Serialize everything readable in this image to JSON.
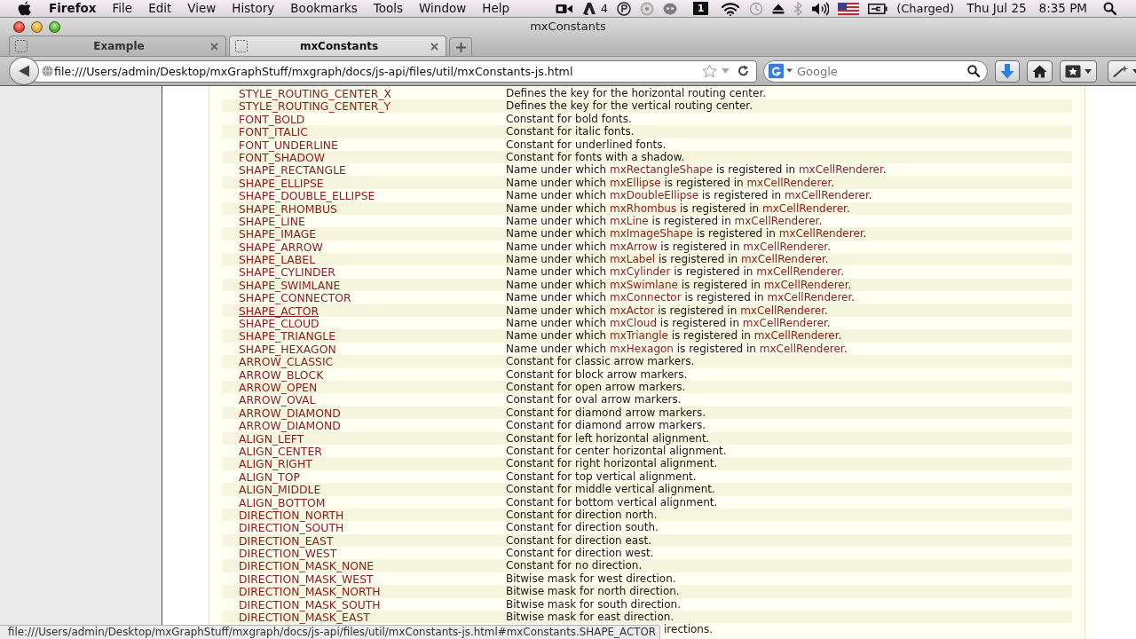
{
  "menu_bar": {
    "app_name": "Firefox",
    "menus": [
      "File",
      "Edit",
      "View",
      "History",
      "Bookmarks",
      "Tools",
      "Window",
      "Help"
    ],
    "extras": {
      "adobe_count": "4",
      "desktop_number": "1",
      "battery": "(Charged)",
      "date": "Thu Jul 25",
      "time": "8:35 PM"
    }
  },
  "window": {
    "title": "mxConstants"
  },
  "tabs": [
    {
      "label": "Example",
      "selected": false
    },
    {
      "label": "mxConstants",
      "selected": true
    }
  ],
  "toolbar": {
    "url": "file:///Users/admin/Desktop/mxGraphStuff/mxgraph/docs/js-api/files/util/mxConstants-js.html",
    "search": {
      "placeholder": "Google"
    }
  },
  "constants": {
    "rows": [
      {
        "name": "STYLE_ROUTING_CENTER_X",
        "hovered": false,
        "description": [
          {
            "text": "Defines the key for the horizontal routing center.",
            "link": false
          }
        ]
      },
      {
        "name": "STYLE_ROUTING_CENTER_Y",
        "hovered": false,
        "description": [
          {
            "text": "Defines the key for the vertical routing center.",
            "link": false
          }
        ]
      },
      {
        "name": "FONT_BOLD",
        "hovered": false,
        "description": [
          {
            "text": "Constant for bold fonts.",
            "link": false
          }
        ]
      },
      {
        "name": "FONT_ITALIC",
        "hovered": false,
        "description": [
          {
            "text": "Constant for italic fonts.",
            "link": false
          }
        ]
      },
      {
        "name": "FONT_UNDERLINE",
        "hovered": false,
        "description": [
          {
            "text": "Constant for underlined fonts.",
            "link": false
          }
        ]
      },
      {
        "name": "FONT_SHADOW",
        "hovered": false,
        "description": [
          {
            "text": "Constant for fonts with a shadow.",
            "link": false
          }
        ]
      },
      {
        "name": "SHAPE_RECTANGLE",
        "hovered": false,
        "description": [
          {
            "text": "Name under which ",
            "link": false
          },
          {
            "text": "mxRectangleShape",
            "link": true
          },
          {
            "text": " is registered in ",
            "link": false
          },
          {
            "text": "mxCellRenderer",
            "link": true
          },
          {
            "text": ".",
            "link": false
          }
        ]
      },
      {
        "name": "SHAPE_ELLIPSE",
        "hovered": false,
        "description": [
          {
            "text": "Name under which ",
            "link": false
          },
          {
            "text": "mxEllipse",
            "link": true
          },
          {
            "text": " is registered in ",
            "link": false
          },
          {
            "text": "mxCellRenderer",
            "link": true
          },
          {
            "text": ".",
            "link": false
          }
        ]
      },
      {
        "name": "SHAPE_DOUBLE_ELLIPSE",
        "hovered": false,
        "description": [
          {
            "text": "Name under which ",
            "link": false
          },
          {
            "text": "mxDoubleEllipse",
            "link": true
          },
          {
            "text": " is registered in ",
            "link": false
          },
          {
            "text": "mxCellRenderer",
            "link": true
          },
          {
            "text": ".",
            "link": false
          }
        ]
      },
      {
        "name": "SHAPE_RHOMBUS",
        "hovered": false,
        "description": [
          {
            "text": "Name under which ",
            "link": false
          },
          {
            "text": "mxRhombus",
            "link": true
          },
          {
            "text": " is registered in ",
            "link": false
          },
          {
            "text": "mxCellRenderer",
            "link": true
          },
          {
            "text": ".",
            "link": false
          }
        ]
      },
      {
        "name": "SHAPE_LINE",
        "hovered": false,
        "description": [
          {
            "text": "Name under which ",
            "link": false
          },
          {
            "text": "mxLine",
            "link": true
          },
          {
            "text": " is registered in ",
            "link": false
          },
          {
            "text": "mxCellRenderer",
            "link": true
          },
          {
            "text": ".",
            "link": false
          }
        ]
      },
      {
        "name": "SHAPE_IMAGE",
        "hovered": false,
        "description": [
          {
            "text": "Name under which ",
            "link": false
          },
          {
            "text": "mxImageShape",
            "link": true
          },
          {
            "text": " is registered in ",
            "link": false
          },
          {
            "text": "mxCellRenderer",
            "link": true
          },
          {
            "text": ".",
            "link": false
          }
        ]
      },
      {
        "name": "SHAPE_ARROW",
        "hovered": false,
        "description": [
          {
            "text": "Name under which ",
            "link": false
          },
          {
            "text": "mxArrow",
            "link": true
          },
          {
            "text": " is registered in ",
            "link": false
          },
          {
            "text": "mxCellRenderer",
            "link": true
          },
          {
            "text": ".",
            "link": false
          }
        ]
      },
      {
        "name": "SHAPE_LABEL",
        "hovered": false,
        "description": [
          {
            "text": "Name under which ",
            "link": false
          },
          {
            "text": "mxLabel",
            "link": true
          },
          {
            "text": " is registered in ",
            "link": false
          },
          {
            "text": "mxCellRenderer",
            "link": true
          },
          {
            "text": ".",
            "link": false
          }
        ]
      },
      {
        "name": "SHAPE_CYLINDER",
        "hovered": false,
        "description": [
          {
            "text": "Name under which ",
            "link": false
          },
          {
            "text": "mxCylinder",
            "link": true
          },
          {
            "text": " is registered in ",
            "link": false
          },
          {
            "text": "mxCellRenderer",
            "link": true
          },
          {
            "text": ".",
            "link": false
          }
        ]
      },
      {
        "name": "SHAPE_SWIMLANE",
        "hovered": false,
        "description": [
          {
            "text": "Name under which ",
            "link": false
          },
          {
            "text": "mxSwimlane",
            "link": true
          },
          {
            "text": " is registered in ",
            "link": false
          },
          {
            "text": "mxCellRenderer",
            "link": true
          },
          {
            "text": ".",
            "link": false
          }
        ]
      },
      {
        "name": "SHAPE_CONNECTOR",
        "hovered": false,
        "description": [
          {
            "text": "Name under which ",
            "link": false
          },
          {
            "text": "mxConnector",
            "link": true
          },
          {
            "text": " is registered in ",
            "link": false
          },
          {
            "text": "mxCellRenderer",
            "link": true
          },
          {
            "text": ".",
            "link": false
          }
        ]
      },
      {
        "name": "SHAPE_ACTOR",
        "hovered": true,
        "description": [
          {
            "text": "Name under which ",
            "link": false
          },
          {
            "text": "mxActor",
            "link": true
          },
          {
            "text": " is registered in ",
            "link": false
          },
          {
            "text": "mxCellRenderer",
            "link": true
          },
          {
            "text": ".",
            "link": false
          }
        ]
      },
      {
        "name": "SHAPE_CLOUD",
        "hovered": false,
        "description": [
          {
            "text": "Name under which ",
            "link": false
          },
          {
            "text": "mxCloud",
            "link": true
          },
          {
            "text": " is registered in ",
            "link": false
          },
          {
            "text": "mxCellRenderer",
            "link": true
          },
          {
            "text": ".",
            "link": false
          }
        ]
      },
      {
        "name": "SHAPE_TRIANGLE",
        "hovered": false,
        "description": [
          {
            "text": "Name under which ",
            "link": false
          },
          {
            "text": "mxTriangle",
            "link": true
          },
          {
            "text": " is registered in ",
            "link": false
          },
          {
            "text": "mxCellRenderer",
            "link": true
          },
          {
            "text": ".",
            "link": false
          }
        ]
      },
      {
        "name": "SHAPE_HEXAGON",
        "hovered": false,
        "description": [
          {
            "text": "Name under which ",
            "link": false
          },
          {
            "text": "mxHexagon",
            "link": true
          },
          {
            "text": " is registered in ",
            "link": false
          },
          {
            "text": "mxCellRenderer",
            "link": true
          },
          {
            "text": ".",
            "link": false
          }
        ]
      },
      {
        "name": "ARROW_CLASSIC",
        "hovered": false,
        "description": [
          {
            "text": "Constant for classic arrow markers.",
            "link": false
          }
        ]
      },
      {
        "name": "ARROW_BLOCK",
        "hovered": false,
        "description": [
          {
            "text": "Constant for block arrow markers.",
            "link": false
          }
        ]
      },
      {
        "name": "ARROW_OPEN",
        "hovered": false,
        "description": [
          {
            "text": "Constant for open arrow markers.",
            "link": false
          }
        ]
      },
      {
        "name": "ARROW_OVAL",
        "hovered": false,
        "description": [
          {
            "text": "Constant for oval arrow markers.",
            "link": false
          }
        ]
      },
      {
        "name": "ARROW_DIAMOND",
        "hovered": false,
        "description": [
          {
            "text": "Constant for diamond arrow markers.",
            "link": false
          }
        ]
      },
      {
        "name": "ARROW_DIAMOND",
        "hovered": false,
        "description": [
          {
            "text": "Constant for diamond arrow markers.",
            "link": false
          }
        ]
      },
      {
        "name": "ALIGN_LEFT",
        "hovered": false,
        "description": [
          {
            "text": "Constant for left horizontal alignment.",
            "link": false
          }
        ]
      },
      {
        "name": "ALIGN_CENTER",
        "hovered": false,
        "description": [
          {
            "text": "Constant for center horizontal alignment.",
            "link": false
          }
        ]
      },
      {
        "name": "ALIGN_RIGHT",
        "hovered": false,
        "description": [
          {
            "text": "Constant for right horizontal alignment.",
            "link": false
          }
        ]
      },
      {
        "name": "ALIGN_TOP",
        "hovered": false,
        "description": [
          {
            "text": "Constant for top vertical alignment.",
            "link": false
          }
        ]
      },
      {
        "name": "ALIGN_MIDDLE",
        "hovered": false,
        "description": [
          {
            "text": "Constant for middle vertical alignment.",
            "link": false
          }
        ]
      },
      {
        "name": "ALIGN_BOTTOM",
        "hovered": false,
        "description": [
          {
            "text": "Constant for bottom vertical alignment.",
            "link": false
          }
        ]
      },
      {
        "name": "DIRECTION_NORTH",
        "hovered": false,
        "description": [
          {
            "text": "Constant for direction north.",
            "link": false
          }
        ]
      },
      {
        "name": "DIRECTION_SOUTH",
        "hovered": false,
        "description": [
          {
            "text": "Constant for direction south.",
            "link": false
          }
        ]
      },
      {
        "name": "DIRECTION_EAST",
        "hovered": false,
        "description": [
          {
            "text": "Constant for direction east.",
            "link": false
          }
        ]
      },
      {
        "name": "DIRECTION_WEST",
        "hovered": false,
        "description": [
          {
            "text": "Constant for direction west.",
            "link": false
          }
        ]
      },
      {
        "name": "DIRECTION_MASK_NONE",
        "hovered": false,
        "description": [
          {
            "text": "Constant for no direction.",
            "link": false
          }
        ]
      },
      {
        "name": "DIRECTION_MASK_WEST",
        "hovered": false,
        "description": [
          {
            "text": "Bitwise mask for west direction.",
            "link": false
          }
        ]
      },
      {
        "name": "DIRECTION_MASK_NORTH",
        "hovered": false,
        "description": [
          {
            "text": "Bitwise mask for north direction.",
            "link": false
          }
        ]
      },
      {
        "name": "DIRECTION_MASK_SOUTH",
        "hovered": false,
        "description": [
          {
            "text": "Bitwise mask for south direction.",
            "link": false
          }
        ]
      },
      {
        "name": "DIRECTION_MASK_EAST",
        "hovered": false,
        "description": [
          {
            "text": "Bitwise mask for east direction.",
            "link": false
          }
        ]
      }
    ],
    "last_row_visible_text": "irections."
  },
  "status_bar": {
    "link_url": "file:///Users/admin/Desktop/mxGraphStuff/mxgraph/docs/js-api/files/util/mxConstants-js.html#mxConstants.SHAPE_ACTOR"
  }
}
